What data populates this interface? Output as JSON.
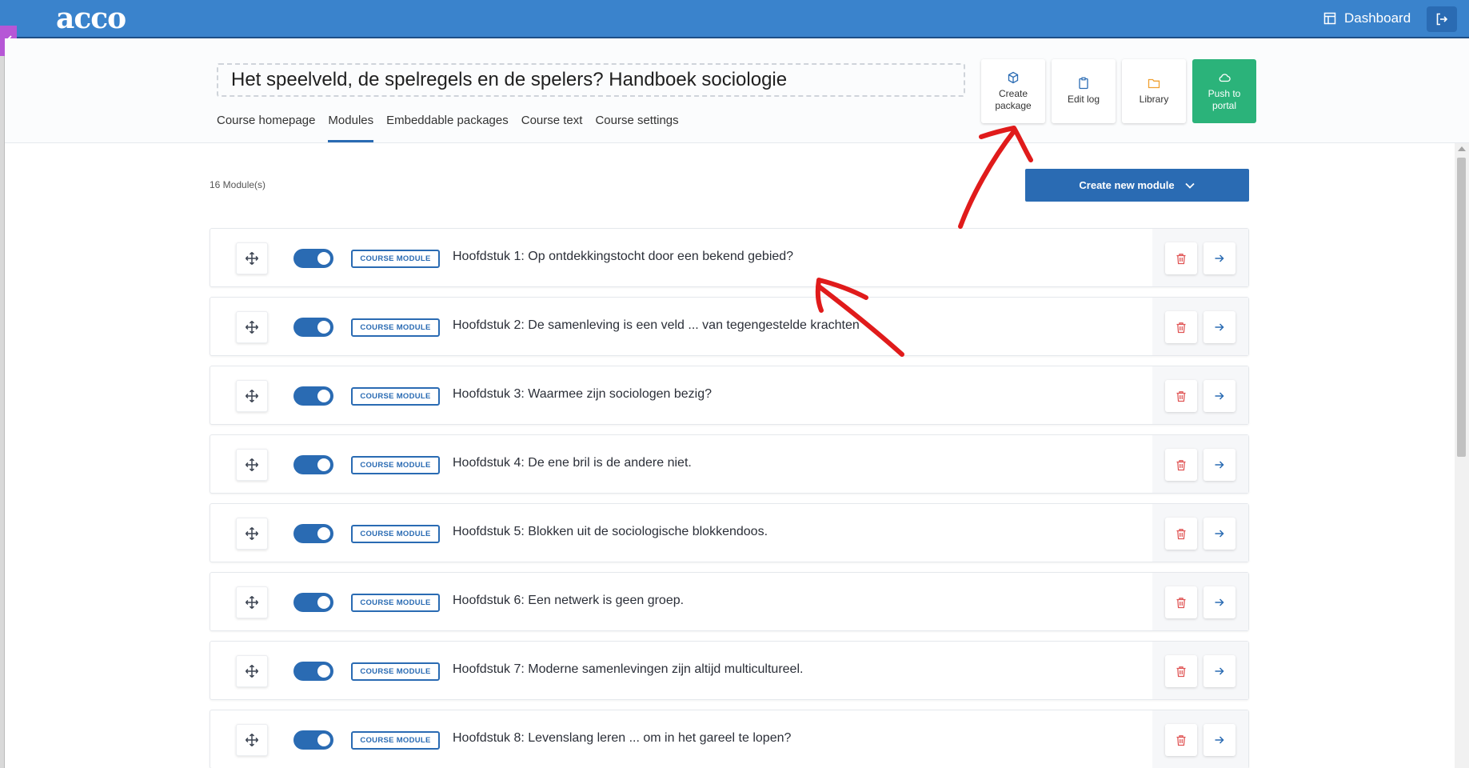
{
  "app": {
    "logo": "acco",
    "dashboard_label": "Dashboard"
  },
  "course": {
    "title": "Het speelveld, de spelregels en de spelers? Handboek sociologie"
  },
  "tabs": [
    {
      "label": "Course homepage",
      "active": false
    },
    {
      "label": "Modules",
      "active": true
    },
    {
      "label": "Embeddable packages",
      "active": false
    },
    {
      "label": "Course text",
      "active": false
    },
    {
      "label": "Course settings",
      "active": false
    }
  ],
  "actions": {
    "create_package": "Create package",
    "edit_log": "Edit log",
    "library": "Library",
    "push_to_portal": "Push to portal"
  },
  "modules_header": {
    "count": "16 Module(s)",
    "create_new": "Create new module"
  },
  "modules": [
    {
      "type": "COURSE MODULE",
      "title": "Hoofdstuk 1: Op ontdekkingstocht door een bekend gebied?",
      "enabled": true
    },
    {
      "type": "COURSE MODULE",
      "title": "Hoofdstuk 2: De samenleving is een veld ... van tegengestelde krachten",
      "enabled": true
    },
    {
      "type": "COURSE MODULE",
      "title": "Hoofdstuk 3: Waarmee zijn sociologen bezig?",
      "enabled": true
    },
    {
      "type": "COURSE MODULE",
      "title": "Hoofdstuk 4: De ene bril is de andere niet.",
      "enabled": true
    },
    {
      "type": "COURSE MODULE",
      "title": "Hoofdstuk 5: Blokken uit de sociologische blokkendoos.",
      "enabled": true
    },
    {
      "type": "COURSE MODULE",
      "title": "Hoofdstuk 6: Een netwerk is geen groep.",
      "enabled": true
    },
    {
      "type": "COURSE MODULE",
      "title": "Hoofdstuk 7: Moderne samenlevingen zijn altijd multicultureel.",
      "enabled": true
    },
    {
      "type": "COURSE MODULE",
      "title": "Hoofdstuk 8: Levenslang leren ... om in het gareel te lopen?",
      "enabled": true
    }
  ],
  "colors": {
    "topbar": "#3a83cc",
    "primary": "#2a6bb3",
    "push_green": "#2bb37a",
    "delete_red": "#e05555",
    "annotation_red": "#e01b1b",
    "sidebar_toggle": "#b657d6"
  }
}
